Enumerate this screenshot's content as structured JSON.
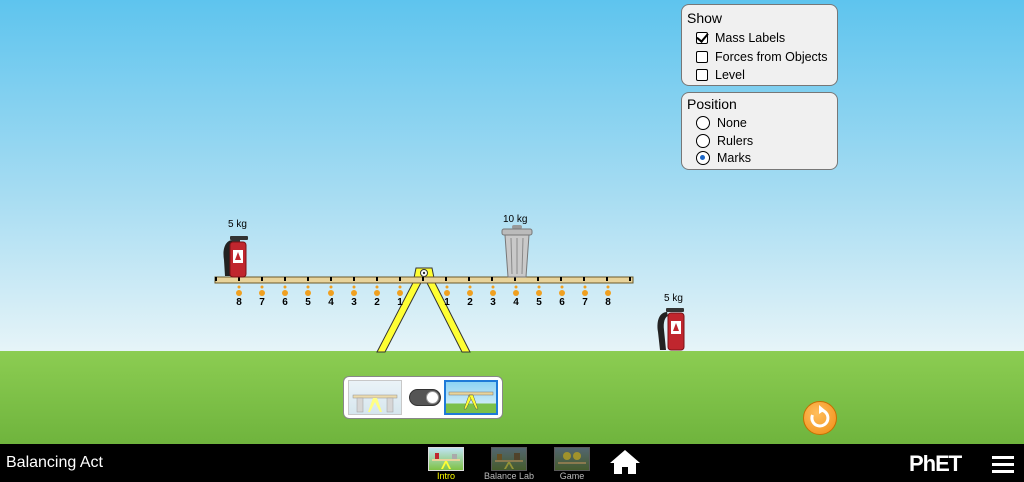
{
  "app": {
    "title": "Balancing Act"
  },
  "show_panel": {
    "title": "Show",
    "options": [
      {
        "label": "Mass Labels",
        "checked": true
      },
      {
        "label": "Forces from Objects",
        "checked": false
      },
      {
        "label": "Level",
        "checked": false
      }
    ]
  },
  "position_panel": {
    "title": "Position",
    "options": [
      {
        "label": "None",
        "selected": false
      },
      {
        "label": "Rulers",
        "selected": false
      },
      {
        "label": "Marks",
        "selected": true
      }
    ]
  },
  "plank": {
    "left_marks": [
      "8",
      "7",
      "6",
      "5",
      "4",
      "3",
      "2",
      "1"
    ],
    "right_marks": [
      "1",
      "2",
      "3",
      "4",
      "5",
      "6",
      "7",
      "8"
    ]
  },
  "masses": {
    "left_extinguisher": "5 kg",
    "trash_can": "10 kg",
    "ground_extinguisher": "5 kg"
  },
  "toggle": {
    "state": "right"
  },
  "nav": {
    "tabs": [
      {
        "label": "Intro",
        "active": true
      },
      {
        "label": "Balance Lab",
        "active": false
      },
      {
        "label": "Game",
        "active": false
      }
    ],
    "home_icon": "home-icon",
    "logo": "PhET",
    "menu_icon": "hamburger-menu-icon"
  },
  "colors": {
    "sky_top": "#5ec4ee",
    "ground": "#7fc246",
    "plank": "#e8d39a",
    "fulcrum": "#ffff33",
    "active_tab_label": "#ffff00",
    "inactive_tab_label": "#bbbbbb",
    "extinguisher": "#c0262e",
    "reset_button": "#f08d14"
  }
}
